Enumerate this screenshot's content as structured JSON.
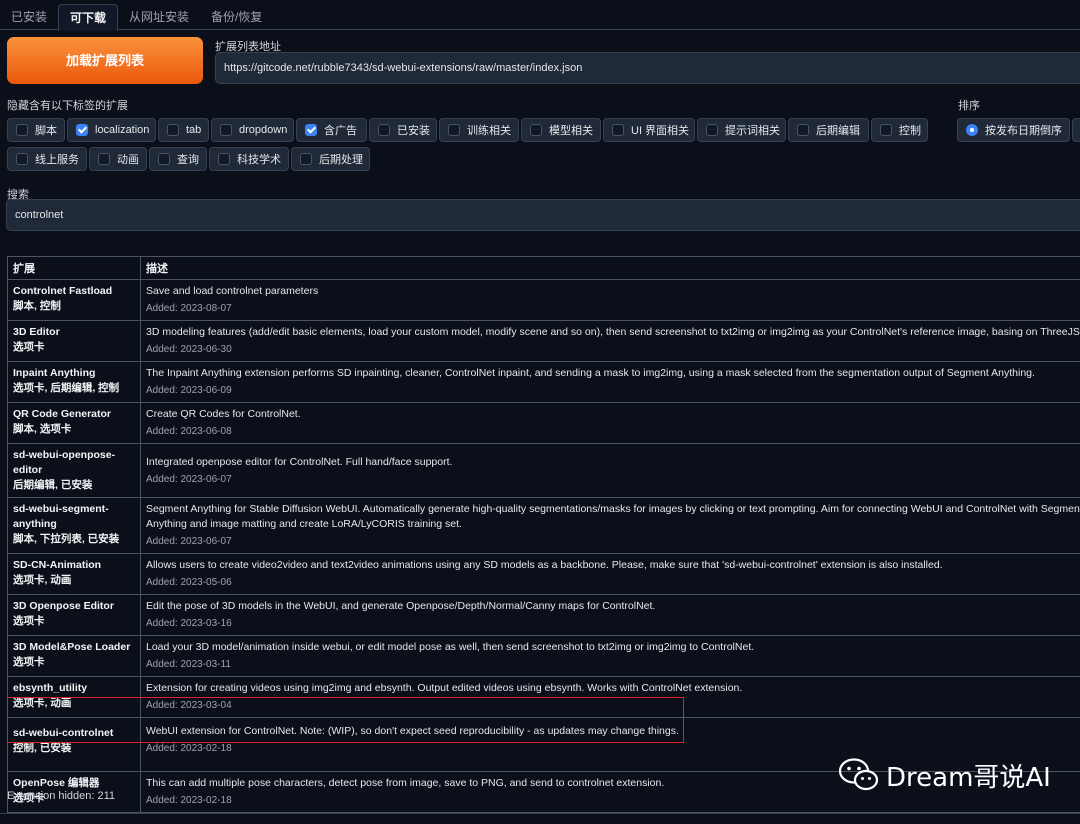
{
  "tabs": [
    {
      "label": "已安装"
    },
    {
      "label": "可下载"
    },
    {
      "label": "从网址安装"
    },
    {
      "label": "备份/恢复"
    }
  ],
  "load_button": "加载扩展列表",
  "url": {
    "label": "扩展列表地址",
    "value": "https://gitcode.net/rubble7343/sd-webui-extensions/raw/master/index.json"
  },
  "hide_label": "隐藏含有以下标签的扩展",
  "filters": [
    {
      "label": "脚本",
      "checked": false
    },
    {
      "label": "localization",
      "checked": true
    },
    {
      "label": "tab",
      "checked": false
    },
    {
      "label": "dropdown",
      "checked": false
    },
    {
      "label": "含广告",
      "checked": true
    },
    {
      "label": "已安装",
      "checked": false
    },
    {
      "label": "训练相关",
      "checked": false
    },
    {
      "label": "模型相关",
      "checked": false
    },
    {
      "label": "UI 界面相关",
      "checked": false
    },
    {
      "label": "提示词相关",
      "checked": false
    },
    {
      "label": "后期编辑",
      "checked": false
    },
    {
      "label": "控制",
      "checked": false
    },
    {
      "label": "线上服务",
      "checked": false
    },
    {
      "label": "动画",
      "checked": false
    },
    {
      "label": "查询",
      "checked": false
    },
    {
      "label": "科技学术",
      "checked": false
    },
    {
      "label": "后期处理",
      "checked": false
    }
  ],
  "sort": {
    "label": "排序",
    "option": "按发布日期倒序"
  },
  "search": {
    "label": "搜索",
    "value": "controlnet"
  },
  "table": {
    "headers": [
      "扩展",
      "描述"
    ],
    "rows": [
      {
        "name": "Controlnet Fastload",
        "tags": "脚本, 控制",
        "desc": "Save and load controlnet parameters",
        "added": "Added: 2023-08-07"
      },
      {
        "name": "3D Editor",
        "tags": "选项卡",
        "desc": "3D modeling features (add/edit basic elements, load your custom model, modify scene and so on), then send screenshot to txt2img or img2img as your ControlNet's reference image, basing on ThreeJS editor.",
        "added": "Added: 2023-06-30"
      },
      {
        "name": "Inpaint Anything",
        "tags": "选项卡, 后期编辑, 控制",
        "desc": "The Inpaint Anything extension performs SD inpainting, cleaner, ControlNet inpaint, and sending a mask to img2img, using a mask selected from the segmentation output of Segment Anything.",
        "added": "Added: 2023-06-09"
      },
      {
        "name": "QR Code Generator",
        "tags": "脚本, 选项卡",
        "desc": "Create QR Codes for ControlNet.",
        "added": "Added: 2023-06-08"
      },
      {
        "name": "sd-webui-openpose-editor",
        "tags": "后期编辑, 已安装",
        "desc": "Integrated openpose editor for ControlNet. Full hand/face support.",
        "added": "Added: 2023-06-07"
      },
      {
        "name": "sd-webui-segment-anything",
        "tags": "脚本, 下拉列表, 已安装",
        "desc": "Segment Anything for Stable Diffusion WebUI. Automatically generate high-quality segmentations/masks for images by clicking or text prompting. Aim for connecting WebUI and ControlNet with Segment Anything and image matting and create LoRA/LyCORIS training set.",
        "added": "Added: 2023-06-07"
      },
      {
        "name": "SD-CN-Animation",
        "tags": "选项卡, 动画",
        "desc": "Allows users to create video2video and text2video animations using any SD models as a backbone. Please, make sure that 'sd-webui-controlnet' extension is also installed.",
        "added": "Added: 2023-05-06"
      },
      {
        "name": "3D Openpose Editor",
        "tags": "选项卡",
        "desc": "Edit the pose of 3D models in the WebUI, and generate Openpose/Depth/Normal/Canny maps for ControlNet.",
        "added": "Added: 2023-03-16"
      },
      {
        "name": "3D Model&Pose Loader",
        "tags": "选项卡",
        "desc": "Load your 3D model/animation inside webui, or edit model pose as well, then send screenshot to txt2img or img2img to ControlNet.",
        "added": "Added: 2023-03-11"
      },
      {
        "name": "ebsynth_utility",
        "tags": "选项卡, 动画",
        "desc": "Extension for creating videos using img2img and ebsynth. Output edited videos using ebsynth. Works with ControlNet extension.",
        "added": "Added: 2023-03-04"
      },
      {
        "name": "sd-webui-controlnet",
        "tags": "控制, 已安装",
        "desc": "WebUI extension for ControlNet. Note: (WIP), so don't expect seed reproducibility - as updates may change things.",
        "added": "Added: 2023-02-18"
      },
      {
        "name": "OpenPose 编辑器",
        "tags": "选项卡",
        "desc": "This can add multiple pose characters, detect pose from image, save to PNG, and send to controlnet extension.",
        "added": "Added: 2023-02-18"
      }
    ]
  },
  "hidden_count": "Extension hidden: 211",
  "watermark": "Dream哥说AI"
}
